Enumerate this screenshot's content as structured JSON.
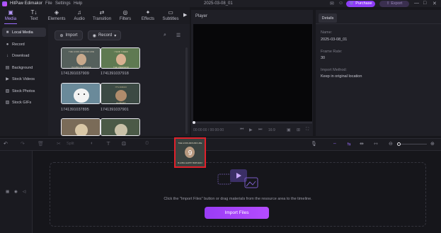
{
  "titlebar": {
    "app_title": "HitPaw Edimakor",
    "menus": [
      "File",
      "Settings",
      "Help"
    ],
    "project_title": "2025-03-08_01",
    "purchase_label": "Purchase",
    "export_label": "Export",
    "controls": [
      "—",
      "□",
      "✕"
    ]
  },
  "tabs": [
    {
      "label": "Media",
      "icon": "media-icon",
      "glyph": "▣"
    },
    {
      "label": "Text",
      "icon": "text-icon",
      "glyph": "T↓"
    },
    {
      "label": "Elements",
      "icon": "elements-icon",
      "glyph": "◈"
    },
    {
      "label": "Audio",
      "icon": "audio-icon",
      "glyph": "♫"
    },
    {
      "label": "Transition",
      "icon": "transition-icon",
      "glyph": "⇄"
    },
    {
      "label": "Filters",
      "icon": "filters-icon",
      "glyph": "◎"
    },
    {
      "label": "Effects",
      "icon": "effects-icon",
      "glyph": "✦"
    },
    {
      "label": "Subtitles",
      "icon": "subtitles-icon",
      "glyph": "▭"
    }
  ],
  "tabs_more": "▶",
  "sidebar": {
    "items": [
      {
        "label": "Local Media",
        "icon": "folder-icon",
        "glyph": "■"
      },
      {
        "label": "Record",
        "icon": "record-icon",
        "glyph": "●"
      },
      {
        "label": "Download",
        "icon": "download-icon",
        "glyph": "↓"
      },
      {
        "label": "Background",
        "icon": "background-icon",
        "glyph": "▤"
      },
      {
        "label": "Stock Videos",
        "icon": "stock-videos-icon",
        "glyph": "▶"
      },
      {
        "label": "Stock Photos",
        "icon": "stock-photos-icon",
        "glyph": "▧"
      },
      {
        "label": "Stock GIFs",
        "icon": "stock-gifs-icon",
        "glyph": "▨"
      }
    ]
  },
  "media": {
    "import_label": "Import",
    "record_label": "Record",
    "items": [
      {
        "label": "1741391037909",
        "top_text": "THE LOOK AROUND LIKE",
        "bottom_text": "IS A BIG SURPRISE",
        "bg": "#55605c",
        "fg": "#d8cdb8"
      },
      {
        "label": "1741391037918",
        "top_text": "I SAID I NEED",
        "bottom_text": "THE WEEKEND",
        "bg": "#5f7a52",
        "fg": "#e2d6b4"
      },
      {
        "label": "1741391037895",
        "top_text": "",
        "bottom_text": "",
        "bg": "#6a8a9a",
        "fg": "#f3f3f3"
      },
      {
        "label": "1741391037901",
        "top_text": "IT'S FRIDAY",
        "bottom_text": "ALREADY",
        "bg": "#3c4a44",
        "fg": "#c3b58e"
      },
      {
        "label": "",
        "top_text": "",
        "bottom_text": "",
        "bg": "#7a6b58",
        "fg": "#d9c7a6"
      },
      {
        "label": "",
        "top_text": "",
        "bottom_text": "",
        "bg": "#4b5a47",
        "fg": "#c9c1a8"
      }
    ]
  },
  "player": {
    "label": "Player",
    "time": "00:00:00 / 00:00:00",
    "zoom": "16:9",
    "controls": [
      "⏮",
      "▶",
      "⏭"
    ]
  },
  "details": {
    "tab_label": "Details",
    "fields": [
      {
        "label": "Name:",
        "value": "2025-03-08_01"
      },
      {
        "label": "Frame Rate:",
        "value": "30"
      },
      {
        "label": "Import Method:",
        "value": "Keep in original location"
      }
    ]
  },
  "toolbar": {
    "split_label": "Split"
  },
  "timeline": {
    "hint": "Click the \"Import Files\" button or drag materials from the resource area to the timeline.",
    "import_files_label": "Import Files"
  },
  "drag_preview": {
    "top_text": "THE LOOK AROUND LIKE",
    "bottom_text": "IS A BIG HAPPY BIRTHDAY"
  },
  "colors": {
    "accent": "#9a3cf6",
    "drag_highlight": "#e0212b",
    "background": "#17171c"
  }
}
